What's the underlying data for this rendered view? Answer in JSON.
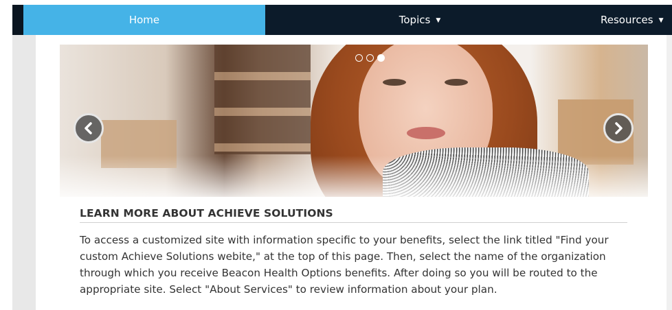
{
  "nav": {
    "home": "Home",
    "topics": "Topics",
    "resources": "Resources",
    "active_color": "#45b3e7",
    "bar_color": "#0c1b2a"
  },
  "carousel": {
    "slide_count": 3,
    "active_slide": 3,
    "prev_icon": "chevron-left-icon",
    "next_icon": "chevron-right-icon"
  },
  "article": {
    "heading": "LEARN MORE ABOUT ACHIEVE SOLUTIONS",
    "body": "To access a customized site with information specific to your benefits, select the link titled \"Find your custom Achieve Solutions webite,\" at the top of this page. Then, select the name of the organization through which you receive Beacon Health Options benefits. After doing so you will be routed to the appropriate site. Select \"About Services\" to review information about your plan."
  }
}
